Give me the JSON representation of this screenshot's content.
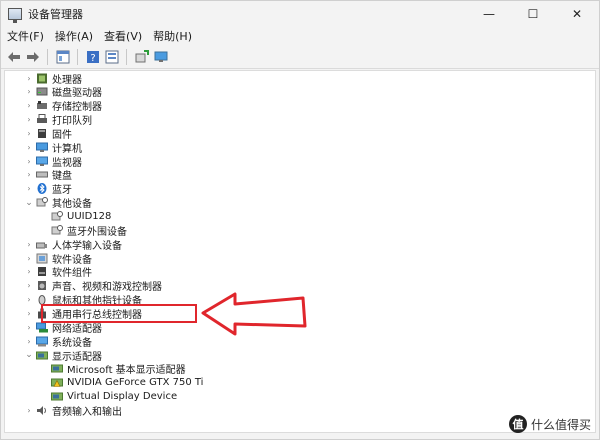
{
  "window": {
    "title": "设备管理器",
    "controls": {
      "minimize": "—",
      "maximize": "☐",
      "close": "✕"
    }
  },
  "menu": [
    "文件(F)",
    "操作(A)",
    "查看(V)",
    "帮助(H)"
  ],
  "toolbar_icons": [
    "back-arrow-icon",
    "forward-arrow-icon",
    "properties-panel-icon",
    "help-icon",
    "show-hidden-icon",
    "scan-hardware-icon",
    "monitor-icon"
  ],
  "tree": [
    {
      "label": "处理器",
      "expanded": false,
      "icon": "processor-icon",
      "level": 1
    },
    {
      "label": "磁盘驱动器",
      "expanded": false,
      "icon": "disk-icon",
      "level": 1
    },
    {
      "label": "存储控制器",
      "expanded": false,
      "icon": "storage-icon",
      "level": 1
    },
    {
      "label": "打印队列",
      "expanded": false,
      "icon": "printer-icon",
      "level": 1
    },
    {
      "label": "固件",
      "expanded": false,
      "icon": "firmware-icon",
      "level": 1
    },
    {
      "label": "计算机",
      "expanded": false,
      "icon": "computer-icon",
      "level": 1
    },
    {
      "label": "监视器",
      "expanded": false,
      "icon": "monitor-icon",
      "level": 1
    },
    {
      "label": "键盘",
      "expanded": false,
      "icon": "keyboard-icon",
      "level": 1
    },
    {
      "label": "蓝牙",
      "expanded": false,
      "icon": "bluetooth-icon",
      "level": 1
    },
    {
      "label": "其他设备",
      "expanded": true,
      "icon": "unknown-device-icon",
      "level": 1
    },
    {
      "label": "UUID128",
      "icon": "unknown-device-icon",
      "level": 2
    },
    {
      "label": "蓝牙外围设备",
      "icon": "unknown-device-icon",
      "level": 2
    },
    {
      "label": "人体学输入设备",
      "expanded": false,
      "icon": "hid-icon",
      "level": 1
    },
    {
      "label": "软件设备",
      "expanded": false,
      "icon": "software-device-icon",
      "level": 1
    },
    {
      "label": "软件组件",
      "expanded": false,
      "icon": "software-component-icon",
      "level": 1
    },
    {
      "label": "声音、视频和游戏控制器",
      "expanded": false,
      "icon": "sound-icon",
      "level": 1
    },
    {
      "label": "鼠标和其他指针设备",
      "expanded": false,
      "icon": "mouse-icon",
      "level": 1
    },
    {
      "label": "通用串行总线控制器",
      "expanded": false,
      "icon": "usb-icon",
      "level": 1
    },
    {
      "label": "网络适配器",
      "expanded": false,
      "icon": "network-icon",
      "level": 1
    },
    {
      "label": "系统设备",
      "expanded": false,
      "icon": "system-device-icon",
      "level": 1
    },
    {
      "label": "显示适配器",
      "expanded": true,
      "icon": "display-adapter-icon",
      "level": 1
    },
    {
      "label": "Microsoft 基本显示适配器",
      "icon": "display-adapter-icon",
      "level": 2
    },
    {
      "label": "NVIDIA GeForce GTX 750 Ti",
      "icon": "display-adapter-warning-icon",
      "level": 2,
      "highlighted": true
    },
    {
      "label": "Virtual Display Device",
      "icon": "display-adapter-icon",
      "level": 2
    },
    {
      "label": "音频输入和输出",
      "expanded": false,
      "icon": "audio-icon",
      "level": 1
    }
  ],
  "colors": {
    "highlight": "#e0262c",
    "window_bg": "#f3f3f3"
  },
  "watermark": {
    "badge": "值",
    "text": "什么值得买"
  }
}
